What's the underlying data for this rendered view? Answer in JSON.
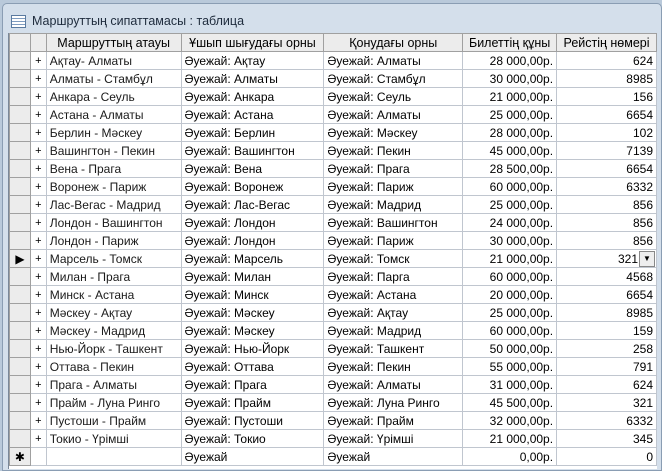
{
  "window": {
    "title": "Маршруттың сипаттамасы : таблица"
  },
  "columns": [
    "Маршруттың атауы",
    "Ұшып шығудағы орны",
    "Қонудағы орны",
    "Билеттің құны",
    "Рейстің нөмері"
  ],
  "rows": [
    [
      "Ақтау- Алматы",
      "Әуежай: Ақтау",
      "Әуежай: Алматы",
      "28 000,00р.",
      "624"
    ],
    [
      "Алматы - Стамбұл",
      "Әуежай: Алматы",
      "Әуежай: Стамбұл",
      "30 000,00р.",
      "8985"
    ],
    [
      "Анкара - Сеуль",
      "Әуежай: Анкара",
      "Әуежай: Сеуль",
      "21 000,00р.",
      "156"
    ],
    [
      "Астана - Алматы",
      "Әуежай: Астана",
      "Әуежай: Алматы",
      "25 000,00р.",
      "6654"
    ],
    [
      "Берлин - Мәскеу",
      "Әуежай: Берлин",
      "Әуежай: Мәскеу",
      "28 000,00р.",
      "102"
    ],
    [
      "Вашингтон - Пекин",
      "Әуежай: Вашингтон",
      "Әуежай: Пекин",
      "45 000,00р.",
      "7139"
    ],
    [
      "Вена - Прага",
      "Әуежай: Вена",
      "Әуежай: Прага",
      "28 500,00р.",
      "6654"
    ],
    [
      "Воронеж - Париж",
      "Әуежай: Воронеж",
      "Әуежай: Париж",
      "60 000,00р.",
      "6332"
    ],
    [
      "Лас-Вегас - Мадрид",
      "Әуежай: Лас-Вегас",
      "Әуежай: Мадрид",
      "25 000,00р.",
      "856"
    ],
    [
      "Лондон - Вашингтон",
      "Әуежай: Лондон",
      "Әуежай: Вашингтон",
      "24 000,00р.",
      "856"
    ],
    [
      "Лондон - Париж",
      "Әуежай: Лондон",
      "Әуежай: Париж",
      "30 000,00р.",
      "856"
    ],
    [
      "Марсель - Томск",
      "Әуежай: Марсель",
      "Әуежай: Томск",
      "21 000,00р.",
      "321"
    ],
    [
      "Милан - Прага",
      "Әуежай: Милан",
      "Әуежай: Парга",
      "60 000,00р.",
      "4568"
    ],
    [
      "Минск - Астана",
      "Әуежай: Минск",
      "Әуежай: Астана",
      "20 000,00р.",
      "6654"
    ],
    [
      "Мәскеу - Ақтау",
      "Әуежай: Мәскеу",
      "Әуежай: Ақтау",
      "25 000,00р.",
      "8985"
    ],
    [
      "Мәскеу - Мадрид",
      "Әуежай: Мәскеу",
      "Әуежай: Мадрид",
      "60 000,00р.",
      "159"
    ],
    [
      "Нью-Йорк - Ташкент",
      "Әуежай: Нью-Йорк",
      "Әуежай: Ташкент",
      "50 000,00р.",
      "258"
    ],
    [
      "Оттава - Пекин",
      "Әуежай: Оттава",
      "Әуежай: Пекин",
      "55 000,00р.",
      "791"
    ],
    [
      "Прага - Алматы",
      "Әуежай: Прага",
      "Әуежай: Алматы",
      "31 000,00р.",
      "624"
    ],
    [
      "Прайм - Луна Ринго",
      "Әуежай: Прайм",
      "Әуежай: Луна Ринго",
      "45 500,00р.",
      "321"
    ],
    [
      "Пустоши - Прайм",
      "Әуежай: Пустоши",
      "Әуежай: Прайм",
      "32 000,00р.",
      "6332"
    ],
    [
      "Токио - Үрімші",
      "Әуежай: Токио",
      "Әуежай: Үрімші",
      "21 000,00р.",
      "345"
    ]
  ],
  "current_row": 11,
  "new_row": [
    "",
    "Әуежай",
    "Әуежай",
    "0,00р.",
    "0"
  ],
  "symbols": {
    "expand": "+",
    "current": "▶",
    "new": "✱",
    "dropdown": "▼"
  }
}
